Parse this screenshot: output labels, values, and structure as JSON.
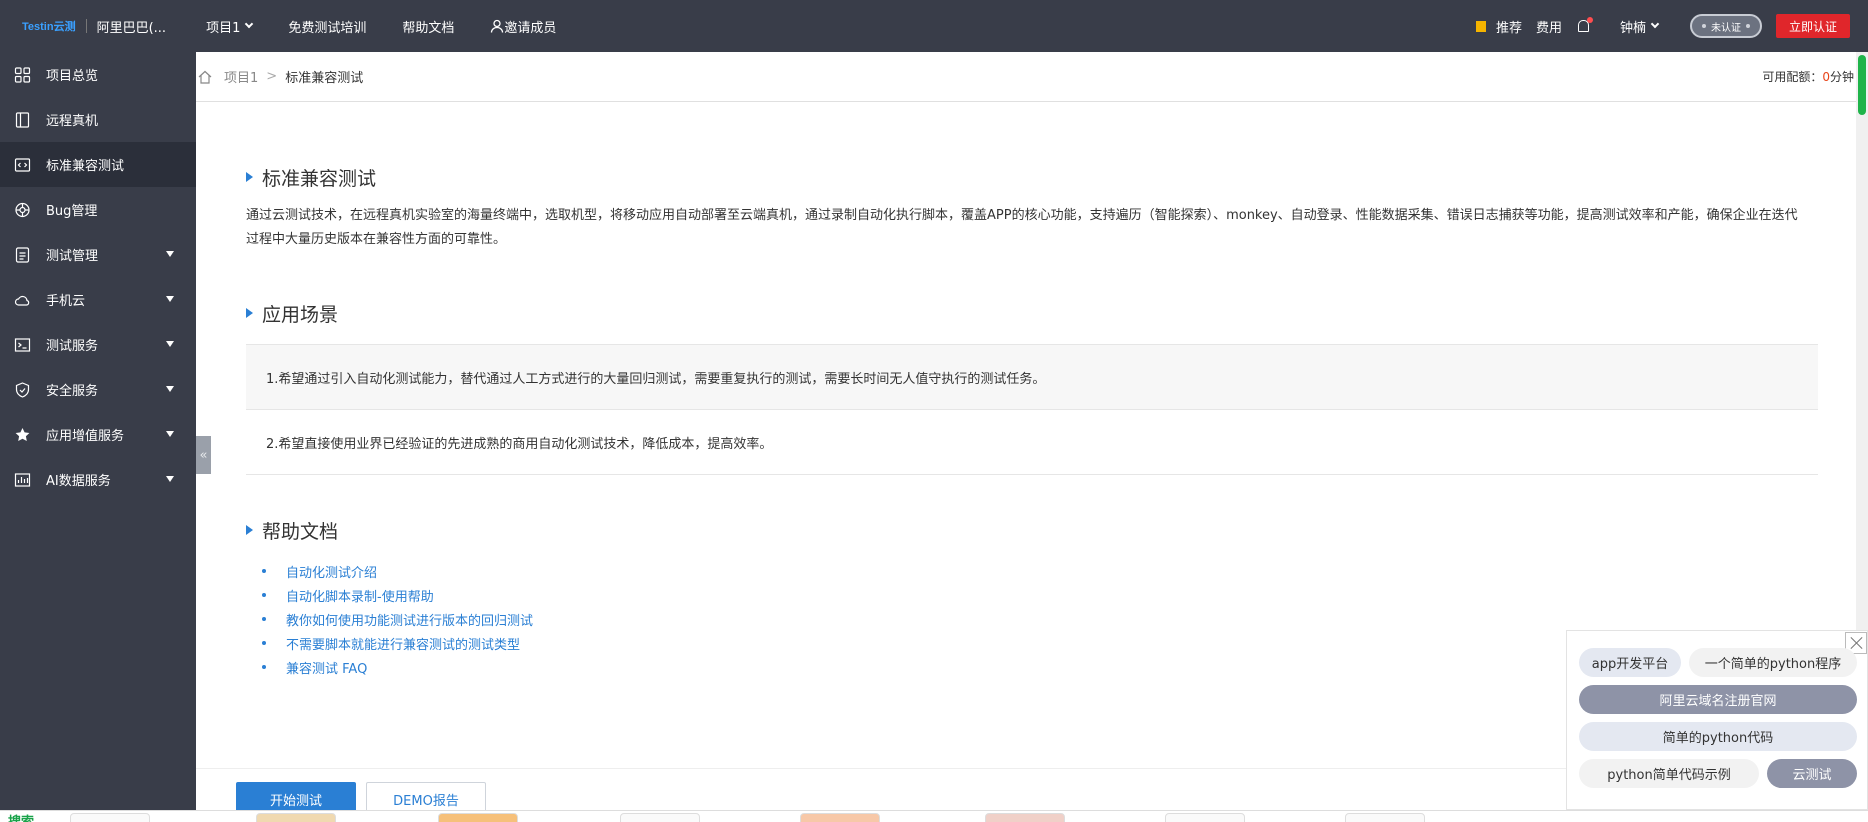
{
  "topbar": {
    "logo": "Testin云测",
    "org": "阿里巴巴(...",
    "project": "项目1",
    "links": [
      "免费测试培训",
      "帮助文档"
    ],
    "invite": "邀请成员",
    "recommend": "推荐",
    "fee": "费用",
    "user": "钟楠",
    "verify_status": "未认证",
    "verify_button": "立即认证"
  },
  "sidebar": {
    "items": [
      {
        "label": "项目总览",
        "icon": "grid-icon"
      },
      {
        "label": "远程真机",
        "icon": "device-icon"
      },
      {
        "label": "标准兼容测试",
        "icon": "code-icon",
        "active": true
      },
      {
        "label": "Bug管理",
        "icon": "bug-icon"
      },
      {
        "label": "测试管理",
        "icon": "document-icon",
        "expandable": true
      },
      {
        "label": "手机云",
        "icon": "cloud-icon",
        "expandable": true
      },
      {
        "label": "测试服务",
        "icon": "terminal-icon",
        "expandable": true
      },
      {
        "label": "安全服务",
        "icon": "shield-icon",
        "expandable": true
      },
      {
        "label": "应用增值服务",
        "icon": "star-icon",
        "expandable": true
      },
      {
        "label": "AI数据服务",
        "icon": "chart-icon",
        "expandable": true
      }
    ],
    "collapse_glyph": "«"
  },
  "breadcrumb": {
    "items": [
      "项目1"
    ],
    "separator": ">",
    "current": "标准兼容测试"
  },
  "quota": {
    "label": "可用配额：",
    "value": "0",
    "unit": "分钟"
  },
  "main": {
    "section1_title": "标准兼容测试",
    "section1_desc": "通过云测试技术，在远程真机实验室的海量终端中，选取机型，将移动应用自动部署至云端真机，通过录制自动化执行脚本，覆盖APP的核心功能，支持遍历（智能探索）、monkey、自动登录、性能数据采集、错误日志捕获等功能，提高测试效率和产能，确保企业在迭代过程中大量历史版本在兼容性方面的可靠性。",
    "section2_title": "应用场景",
    "scenarios": [
      "1.希望通过引入自动化测试能力，替代通过人工方式进行的大量回归测试，需要重复执行的测试，需要长时间无人值守执行的测试任务。",
      "2.希望直接使用业界已经验证的先进成熟的商用自动化测试技术，降低成本，提高效率。"
    ],
    "section3_title": "帮助文档",
    "help_links": [
      "自动化测试介绍",
      "自动化脚本录制-使用帮助",
      "教你如何使用功能测试进行版本的回归测试",
      "不需要脚本就能进行兼容测试的测试类型",
      "兼容测试 FAQ"
    ]
  },
  "bottom": {
    "start_button": "开始测试",
    "demo_button": "DEMO报告",
    "strip_text": "搜索"
  },
  "ad": {
    "pills": [
      "app开发平台",
      "一个简单的python程序",
      "阿里云域名注册官网",
      "简单的python代码",
      "python简单代码示例",
      "云测试"
    ]
  },
  "colors": {
    "sidebar_bg": "#393d49",
    "accent": "#2a7fd4",
    "verify_red": "#e0262b",
    "quota_zero": "#e8451a"
  }
}
